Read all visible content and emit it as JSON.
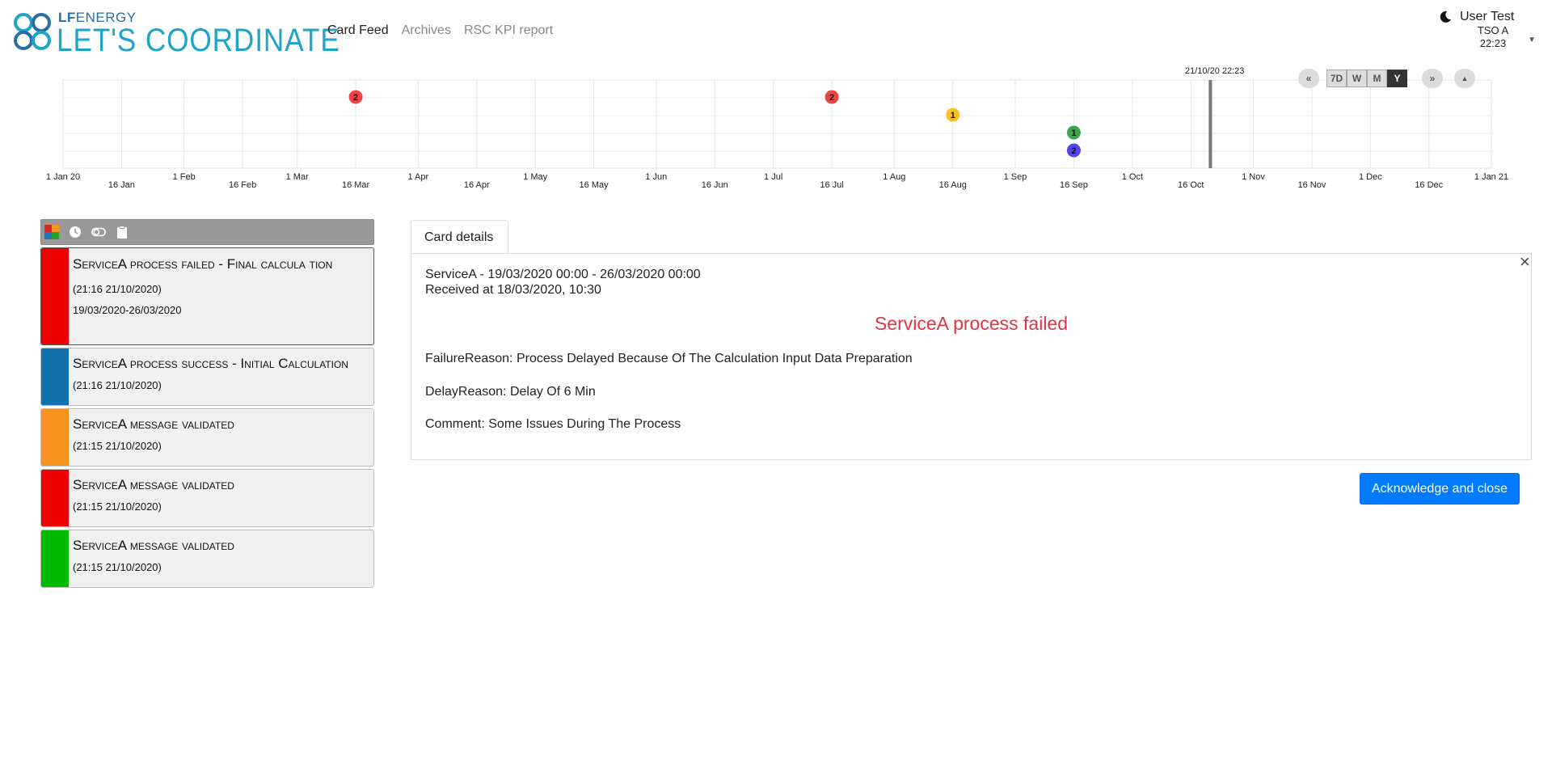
{
  "brand": {
    "top_strong": "LF",
    "top_thin": "ENERGY",
    "main": "LET'S COORDINATE"
  },
  "nav": [
    {
      "label": "Card Feed",
      "active": true
    },
    {
      "label": "Archives",
      "active": false
    },
    {
      "label": "RSC KPI report",
      "active": false
    }
  ],
  "user": {
    "name": "User Test",
    "entity": "TSO A",
    "time": "22:23"
  },
  "timeline": {
    "now_label": "21/10/20 22:23",
    "controls": {
      "prev_icon": "double-chevron-left-icon",
      "next_icon": "double-chevron-right-icon",
      "collapse_icon": "caret-up-icon",
      "ranges": [
        "7D",
        "W",
        "M",
        "Y"
      ],
      "active_range": "Y"
    },
    "start": "2020-01-01",
    "end": "2021-01-01",
    "now": "2020-10-21",
    "ticks": [
      {
        "date": "2020-01-01",
        "label": "1 Jan 20",
        "row": 0
      },
      {
        "date": "2020-01-16",
        "label": "16 Jan",
        "row": 1
      },
      {
        "date": "2020-02-01",
        "label": "1 Feb",
        "row": 0
      },
      {
        "date": "2020-02-16",
        "label": "16 Feb",
        "row": 1
      },
      {
        "date": "2020-03-01",
        "label": "1 Mar",
        "row": 0
      },
      {
        "date": "2020-03-16",
        "label": "16 Mar",
        "row": 1
      },
      {
        "date": "2020-04-01",
        "label": "1 Apr",
        "row": 0
      },
      {
        "date": "2020-04-16",
        "label": "16 Apr",
        "row": 1
      },
      {
        "date": "2020-05-01",
        "label": "1 May",
        "row": 0
      },
      {
        "date": "2020-05-16",
        "label": "16 May",
        "row": 1
      },
      {
        "date": "2020-06-01",
        "label": "1 Jun",
        "row": 0
      },
      {
        "date": "2020-06-16",
        "label": "16 Jun",
        "row": 1
      },
      {
        "date": "2020-07-01",
        "label": "1 Jul",
        "row": 0
      },
      {
        "date": "2020-07-16",
        "label": "16 Jul",
        "row": 1
      },
      {
        "date": "2020-08-01",
        "label": "1 Aug",
        "row": 0
      },
      {
        "date": "2020-08-16",
        "label": "16 Aug",
        "row": 1
      },
      {
        "date": "2020-09-01",
        "label": "1 Sep",
        "row": 0
      },
      {
        "date": "2020-09-16",
        "label": "16 Sep",
        "row": 1
      },
      {
        "date": "2020-10-01",
        "label": "1 Oct",
        "row": 0
      },
      {
        "date": "2020-10-16",
        "label": "16 Oct",
        "row": 1
      },
      {
        "date": "2020-11-01",
        "label": "1 Nov",
        "row": 0
      },
      {
        "date": "2020-11-16",
        "label": "16 Nov",
        "row": 1
      },
      {
        "date": "2020-12-01",
        "label": "1 Dec",
        "row": 0
      },
      {
        "date": "2020-12-16",
        "label": "16 Dec",
        "row": 1
      },
      {
        "date": "2021-01-01",
        "label": "1 Jan 21",
        "row": 0
      }
    ],
    "bubbles": [
      {
        "date": "2020-03-16",
        "lane": 1,
        "count": "2",
        "color": "#ef4444"
      },
      {
        "date": "2020-07-16",
        "lane": 1,
        "count": "2",
        "color": "#ef4444"
      },
      {
        "date": "2020-08-16",
        "lane": 2,
        "count": "1",
        "color": "#fbbf24"
      },
      {
        "date": "2020-09-16",
        "lane": 3,
        "count": "1",
        "color": "#3fa34d"
      },
      {
        "date": "2020-09-16",
        "lane": 4,
        "count": "2",
        "color": "#4f46e5"
      }
    ]
  },
  "feed": {
    "toolbar_icons": [
      "type-filter-icon",
      "clock-icon",
      "toggle-icon",
      "clipboard-icon"
    ],
    "cards": [
      {
        "title": "ServiceA process failed - Final calcula tion",
        "time": "(21:16 21/10/2020)",
        "range": "19/03/2020-26/03/2020",
        "color": "#ee0000",
        "selected": true
      },
      {
        "title": "ServiceA process success - Initial Calculation",
        "time": "(21:16 21/10/2020)",
        "range": "",
        "color": "#1271ad",
        "selected": false
      },
      {
        "title": "ServiceA message validated",
        "time": "(21:15 21/10/2020)",
        "range": "",
        "color": "#f7931e",
        "selected": false
      },
      {
        "title": "ServiceA message validated",
        "time": "(21:15 21/10/2020)",
        "range": "",
        "color": "#ee0000",
        "selected": false
      },
      {
        "title": "ServiceA message validated",
        "time": "(21:15 21/10/2020)",
        "range": "",
        "color": "#00bb00",
        "selected": false
      }
    ]
  },
  "details": {
    "tab": "Card details",
    "close_icon": "close-icon",
    "line1": "ServiceA - 19/03/2020 00:00 - 26/03/2020 00:00",
    "line2": "Received at 18/03/2020, 10:30",
    "title": "ServiceA process failed",
    "failure": "FailureReason: Process Delayed Because Of The Calculation Input Data Preparation",
    "delay": "DelayReason: Delay Of 6 Min",
    "comment": "Comment: Some Issues During The Process",
    "close_glyph": "×",
    "ack_label": "Acknowledge and close"
  }
}
